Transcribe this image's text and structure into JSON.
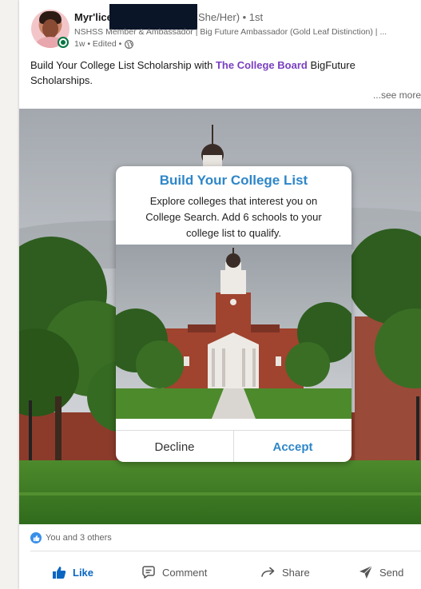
{
  "post": {
    "author_name": "Myr'lice",
    "author_pronouns": "She/Her) • 1st",
    "author_headline": "NSHSS Member & Ambassador | Big Future Ambassador (Gold Leaf Distinction) | ...",
    "meta": "1w • Edited •",
    "text_before_link": "Build Your College List Scholarship with ",
    "link_text": "The College Board",
    "text_after_link": " BigFuture Scholarships.",
    "see_more": "...see more"
  },
  "modal": {
    "title": "Build Your College List",
    "body": "Explore colleges that interest you on College Search. Add 6 schools to your college list to qualify.",
    "decline_label": "Decline",
    "accept_label": "Accept"
  },
  "reactions": {
    "text": "You and 3 others"
  },
  "actions": {
    "like": "Like",
    "comment": "Comment",
    "share": "Share",
    "send": "Send"
  },
  "colors": {
    "accent_blue": "#0a66c2",
    "modal_blue": "#2d86c8",
    "link_purple": "#7a3fc1",
    "online_green": "#057642"
  },
  "icons": [
    "globe-icon",
    "like-icon",
    "comment-icon",
    "share-icon",
    "send-icon",
    "online-status-icon"
  ]
}
